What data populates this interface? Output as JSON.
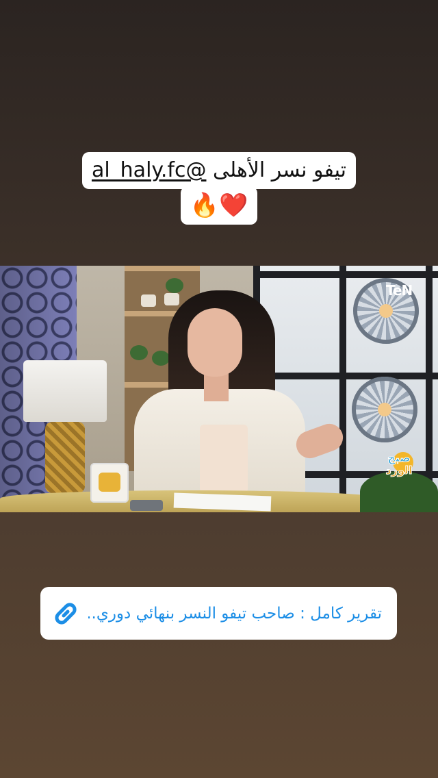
{
  "story": {
    "caption_line1_text": "تيفو نسر الأهلى ",
    "caption_mention": "@al_haly.fc",
    "caption_emojis": "🔥❤️"
  },
  "video": {
    "channel_logo": "TeN",
    "show_logo_line1": "صبح",
    "show_logo_line2": "الورد"
  },
  "link_sticker": {
    "icon": "link-icon",
    "text": "تقرير كامل : صاحب تيفو النسر بنهائي دوري...",
    "color": "#1c8ee6"
  }
}
